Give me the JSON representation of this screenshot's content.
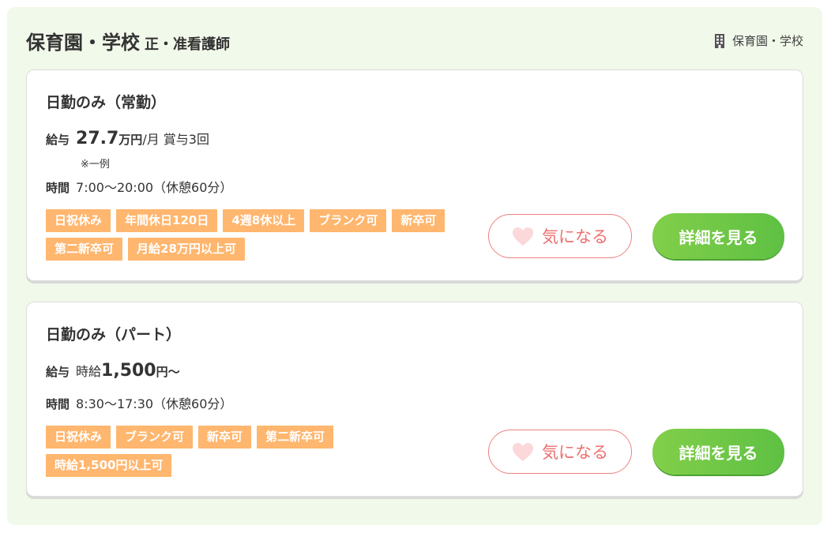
{
  "facility": {
    "name": "保育園・学校",
    "job": "正・准看護師",
    "type_label": "保育園・学校"
  },
  "jobs": [
    {
      "title": "日勤のみ（常勤）",
      "salary_label": "給与",
      "salary_prefix": "",
      "salary_amount": "27.7",
      "salary_unit": "万円",
      "salary_suffix": "/月 賞与3回",
      "salary_note": "※一例",
      "time_label": "時間",
      "time_value": "7:00〜20:00（休憩60分）",
      "tags": [
        "日祝休み",
        "年間休日120日",
        "4週8休以上",
        "ブランク可",
        "新卒可",
        "第二新卒可",
        "月給28万円以上可"
      ],
      "fav_label": "気になる",
      "detail_label": "詳細を見る"
    },
    {
      "title": "日勤のみ（パート）",
      "salary_label": "給与",
      "salary_prefix": "時給",
      "salary_amount": "1,500",
      "salary_unit": "円〜",
      "salary_suffix": "",
      "time_label": "時間",
      "time_value": "8:30〜17:30（休憩60分）",
      "tags": [
        "日祝休み",
        "ブランク可",
        "新卒可",
        "第二新卒可",
        "時給1,500円以上可"
      ],
      "fav_label": "気になる",
      "detail_label": "詳細を見る"
    }
  ],
  "icons": {
    "building": "building-icon",
    "heart": "heart-icon"
  },
  "colors": {
    "panel_bg": "#f1f9ea",
    "tag_bg": "#ffb66e",
    "fav_border": "#f08080",
    "detail_green": "#6cc645"
  }
}
